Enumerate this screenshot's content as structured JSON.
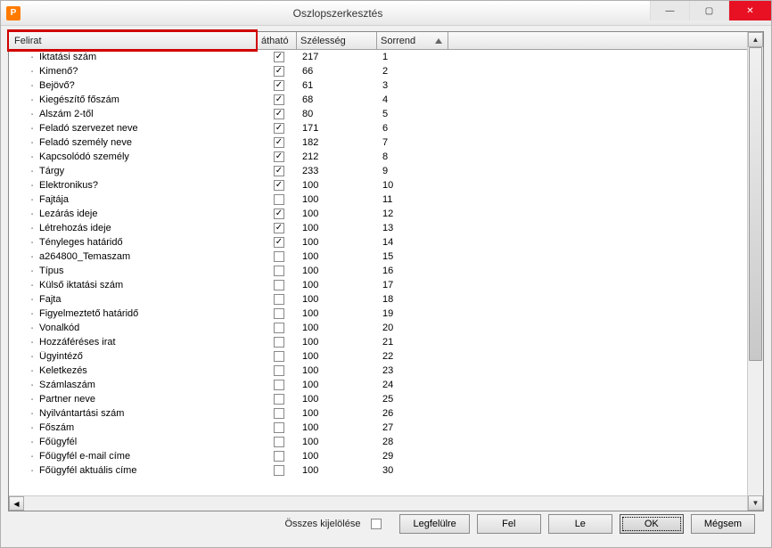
{
  "window": {
    "title": "Oszlopszerkesztés"
  },
  "headers": {
    "felirat": "Felirat",
    "lathato": "átható",
    "szelesseg": "Szélesség",
    "sorrend": "Sorrend"
  },
  "rows": [
    {
      "label": "Iktatási szám",
      "checked": true,
      "width": "217",
      "order": "1"
    },
    {
      "label": "Kimenő?",
      "checked": true,
      "width": "66",
      "order": "2"
    },
    {
      "label": "Bejövő?",
      "checked": true,
      "width": "61",
      "order": "3"
    },
    {
      "label": "Kiegészítő főszám",
      "checked": true,
      "width": "68",
      "order": "4"
    },
    {
      "label": "Alszám 2-től",
      "checked": true,
      "width": "80",
      "order": "5"
    },
    {
      "label": "Feladó szervezet neve",
      "checked": true,
      "width": "171",
      "order": "6"
    },
    {
      "label": "Feladó személy neve",
      "checked": true,
      "width": "182",
      "order": "7"
    },
    {
      "label": "Kapcsolódó személy",
      "checked": true,
      "width": "212",
      "order": "8"
    },
    {
      "label": "Tárgy",
      "checked": true,
      "width": "233",
      "order": "9"
    },
    {
      "label": "Elektronikus?",
      "checked": true,
      "width": "100",
      "order": "10"
    },
    {
      "label": "Fajtája",
      "checked": false,
      "width": "100",
      "order": "11"
    },
    {
      "label": "Lezárás ideje",
      "checked": true,
      "width": "100",
      "order": "12"
    },
    {
      "label": "Létrehozás ideje",
      "checked": true,
      "width": "100",
      "order": "13"
    },
    {
      "label": "Tényleges határidő",
      "checked": true,
      "width": "100",
      "order": "14"
    },
    {
      "label": "a264800_Temaszam",
      "checked": false,
      "width": "100",
      "order": "15"
    },
    {
      "label": "Típus",
      "checked": false,
      "width": "100",
      "order": "16"
    },
    {
      "label": "Külső iktatási szám",
      "checked": false,
      "width": "100",
      "order": "17"
    },
    {
      "label": "Fajta",
      "checked": false,
      "width": "100",
      "order": "18"
    },
    {
      "label": "Figyelmeztető határidő",
      "checked": false,
      "width": "100",
      "order": "19"
    },
    {
      "label": "Vonalkód",
      "checked": false,
      "width": "100",
      "order": "20"
    },
    {
      "label": "Hozzáféréses irat",
      "checked": false,
      "width": "100",
      "order": "21"
    },
    {
      "label": "Ügyintéző",
      "checked": false,
      "width": "100",
      "order": "22"
    },
    {
      "label": "Keletkezés",
      "checked": false,
      "width": "100",
      "order": "23"
    },
    {
      "label": "Számlaszám",
      "checked": false,
      "width": "100",
      "order": "24"
    },
    {
      "label": "Partner neve",
      "checked": false,
      "width": "100",
      "order": "25"
    },
    {
      "label": "Nyilvántartási szám",
      "checked": false,
      "width": "100",
      "order": "26"
    },
    {
      "label": "Főszám",
      "checked": false,
      "width": "100",
      "order": "27"
    },
    {
      "label": "Főügyfél",
      "checked": false,
      "width": "100",
      "order": "28"
    },
    {
      "label": "Főügyfél e-mail címe",
      "checked": false,
      "width": "100",
      "order": "29"
    },
    {
      "label": "Főügyfél aktuális címe",
      "checked": false,
      "width": "100",
      "order": "30"
    }
  ],
  "footer": {
    "select_all": "Összes kijelölése",
    "topmost": "Legfelülre",
    "up": "Fel",
    "down": "Le",
    "ok": "OK",
    "cancel": "Mégsem"
  }
}
